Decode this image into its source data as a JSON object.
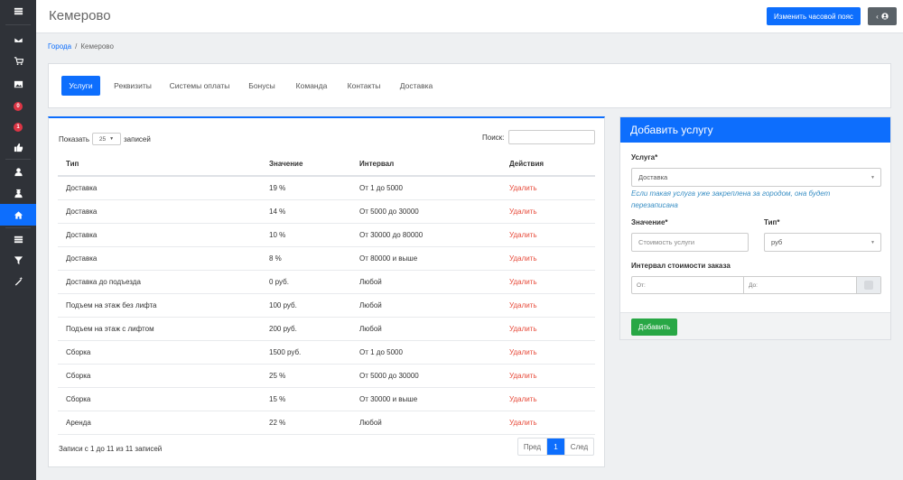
{
  "header": {
    "title": "Кемерово",
    "timezone_button": "Изменить часовой пояс",
    "user_button_caret": "‹"
  },
  "breadcrumb": {
    "root": "Города",
    "separator": "/",
    "current": "Кемерово"
  },
  "sidebar": {
    "badges": {
      "orders_new": "0",
      "orders_other": "1"
    },
    "active_item": "home-icon"
  },
  "tabs": [
    "Услуги",
    "Реквизиты",
    "Системы оплаты",
    "Бонусы",
    "Команда",
    "Контакты",
    "Доставка"
  ],
  "table": {
    "show_label": "Показать",
    "show_value": "25",
    "records_label": "записей",
    "search_label": "Поиск:",
    "columns": [
      "Тип",
      "Значение",
      "Интервал",
      "Действия"
    ],
    "rows": [
      [
        "Доставка",
        "19 %",
        "От 1 до 5000",
        "Удалить"
      ],
      [
        "Доставка",
        "14 %",
        "От 5000 до 30000",
        "Удалить"
      ],
      [
        "Доставка",
        "10 %",
        "От 30000 до 80000",
        "Удалить"
      ],
      [
        "Доставка",
        "8 %",
        "От 80000 и выше",
        "Удалить"
      ],
      [
        "Доставка до подъезда",
        "0 руб.",
        "Любой",
        "Удалить"
      ],
      [
        "Подъем на этаж без лифта",
        "100 руб.",
        "Любой",
        "Удалить"
      ],
      [
        "Подъем на этаж с лифтом",
        "200 руб.",
        "Любой",
        "Удалить"
      ],
      [
        "Сборка",
        "1500 руб.",
        "От 1 до 5000",
        "Удалить"
      ],
      [
        "Сборка",
        "25 %",
        "От 5000 до 30000",
        "Удалить"
      ],
      [
        "Сборка",
        "15 %",
        "От 30000 и выше",
        "Удалить"
      ],
      [
        "Аренда",
        "22 %",
        "Любой",
        "Удалить"
      ]
    ],
    "info": "Записи с 1 до 11 из 11 записей",
    "pager": {
      "prev": "Пред",
      "current": "1",
      "next": "След"
    }
  },
  "form": {
    "title": "Добавить услугу",
    "service_label": "Услуга*",
    "service_value": "Доставка",
    "hint": "Если такая услуга уже закреплена за городом, она будет перезаписана",
    "value_label": "Значение*",
    "value_placeholder": "Стоимость услуги",
    "type_label": "Тип*",
    "type_value": "руб",
    "interval_label": "Интервал стоимости заказа",
    "from_placeholder": "От:",
    "to_placeholder": "До:",
    "submit": "Добавить"
  },
  "colors": {
    "primary": "#0d6efd",
    "success": "#28a745",
    "danger": "#e74c3c",
    "sidebar": "#2f3238"
  }
}
